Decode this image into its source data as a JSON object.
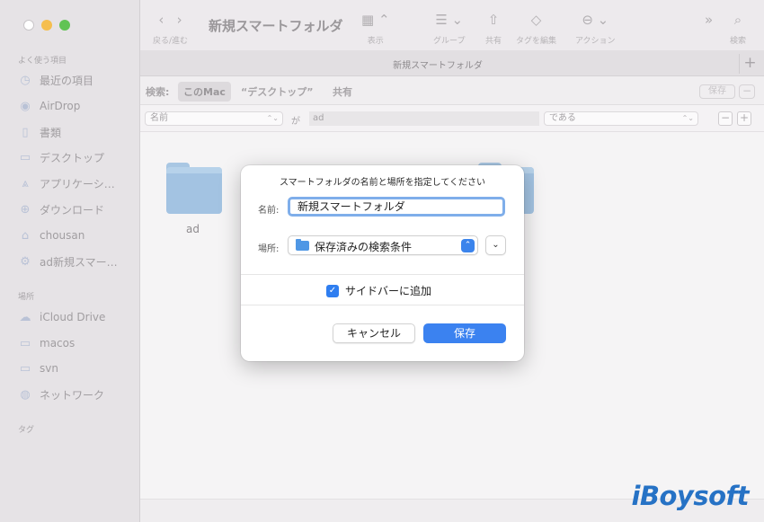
{
  "window": {
    "title": "新規スマートフォルダ",
    "tab_title": "新規スマートフォルダ",
    "add_tab": "+"
  },
  "sidebar": {
    "favorites_heading": "よく使う項目",
    "favorites": [
      {
        "label": "最近の項目",
        "icon": "clock-icon"
      },
      {
        "label": "AirDrop",
        "icon": "airdrop-icon"
      },
      {
        "label": "書類",
        "icon": "document-icon"
      },
      {
        "label": "デスクトップ",
        "icon": "desktop-icon"
      },
      {
        "label": "アプリケーシ…",
        "icon": "applications-icon"
      },
      {
        "label": "ダウンロード",
        "icon": "download-icon"
      },
      {
        "label": "chousan",
        "icon": "home-icon"
      },
      {
        "label": "ad新規スマー…",
        "icon": "smart-folder-icon"
      }
    ],
    "locations_heading": "場所",
    "locations": [
      {
        "label": "iCloud Drive",
        "icon": "cloud-icon"
      },
      {
        "label": "macos",
        "icon": "disk-icon"
      },
      {
        "label": "svn",
        "icon": "disk-icon"
      },
      {
        "label": "ネットワーク",
        "icon": "network-icon"
      }
    ],
    "tags_heading": "タグ"
  },
  "toolbar": {
    "back_forward_label": "戻る/進む",
    "view_label": "表示",
    "group_label": "グループ",
    "share_label": "共有",
    "tags_label": "タグを編集",
    "action_label": "アクション",
    "search_label": "検索"
  },
  "scope": {
    "label": "検索:",
    "this_mac": "このMac",
    "desktop": "“デスクトップ”",
    "shared": "共有",
    "save": "保存",
    "minus": "−"
  },
  "criteria": {
    "attribute": "名前",
    "connector": "が",
    "value": "ad",
    "operator": "である",
    "minus": "−",
    "plus": "+"
  },
  "content": {
    "items": [
      {
        "label": "ad"
      }
    ]
  },
  "dialog": {
    "title": "スマートフォルダの名前と場所を指定してください",
    "name_label": "名前:",
    "name_value": "新規スマートフォルダ",
    "location_label": "場所:",
    "location_value": "保存済みの検索条件",
    "sidebar_checkbox": "サイドバーに追加",
    "cancel": "キャンセル",
    "save": "保存"
  },
  "brand": "iBoysoft",
  "colors": {
    "accent": "#3b82f0",
    "focus_ring": "#7faeea",
    "brand": "#2672c5"
  }
}
